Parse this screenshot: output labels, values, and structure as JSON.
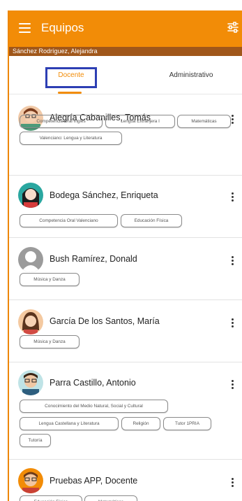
{
  "app": {
    "title": "Equipos",
    "user": "Sánchez Rodríguez, Alejandra"
  },
  "tabs": [
    "Docente",
    "Administrativo"
  ],
  "teachers": [
    {
      "name": "Alegría Cabanilles, Tomás",
      "subjects": [
        "Competencia Oral Inglés",
        "Lengua Extranjera I",
        "Matemáticas",
        "Valenciano: Lengua y Literatura"
      ]
    },
    {
      "name": "Bodega Sánchez, Enriqueta",
      "subjects": [
        "Competencia Oral Valenciano",
        "Educación Física"
      ]
    },
    {
      "name": "Bush Ramírez, Donald",
      "subjects": [
        "Música y Danza"
      ]
    },
    {
      "name": "García De los Santos, María",
      "subjects": [
        "Música y Danza"
      ]
    },
    {
      "name": "Parra Castillo, Antonio",
      "subjects": [
        "Conocimiento del Medio Natural, Social y Cultural",
        "Lengua Castellana y Literatura",
        "Religión",
        "Tutor 1PRIA",
        "Tutoría"
      ]
    },
    {
      "name": "Pruebas APP, Docente",
      "subjects": [
        "Educación Física",
        "Matemáticas"
      ]
    }
  ],
  "colors": {
    "primary": "#f28c07",
    "subbar": "#a0571a",
    "tab_highlight": "#2d3fb4"
  },
  "icons": [
    "menu-icon",
    "filter-icon",
    "more-vert-icon",
    "avatar-icon"
  ]
}
